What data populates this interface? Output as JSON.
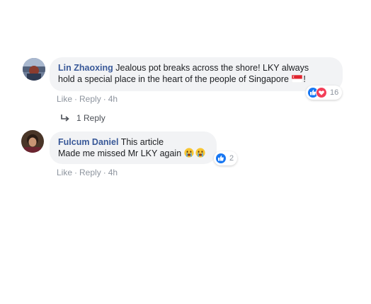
{
  "comments": [
    {
      "author": "Lin Zhaoxing",
      "text_line1": "Jealous pot breaks across the shore! LKY always",
      "text_line2": "hold a special place in the heart of the people of Singapore",
      "text_line2_tail": "!",
      "like_label": "Like",
      "reply_label": "Reply",
      "time": "4h",
      "reaction_count": "16",
      "reactions": [
        "like-icon",
        "love-icon"
      ],
      "inline_icons": [
        "singapore-flag-icon"
      ]
    },
    {
      "author": "Fulcum Daniel",
      "text_line1": "This article",
      "text_line2": "Made me missed Mr LKY again",
      "like_label": "Like",
      "reply_label": "Reply",
      "time": "4h",
      "reaction_count": "2",
      "reactions": [
        "like-icon"
      ],
      "inline_icons": [
        "crying-face-icon",
        "crying-face-icon"
      ]
    }
  ],
  "replies_link": {
    "label": "1 Reply",
    "icon": "reply-arrow-icon"
  },
  "separator": "·",
  "colors": {
    "author": "#385898",
    "bubble": "#f2f3f5",
    "meta": "#8d949e",
    "like_blue": "#1877f2",
    "love_red": "#f33e58"
  }
}
